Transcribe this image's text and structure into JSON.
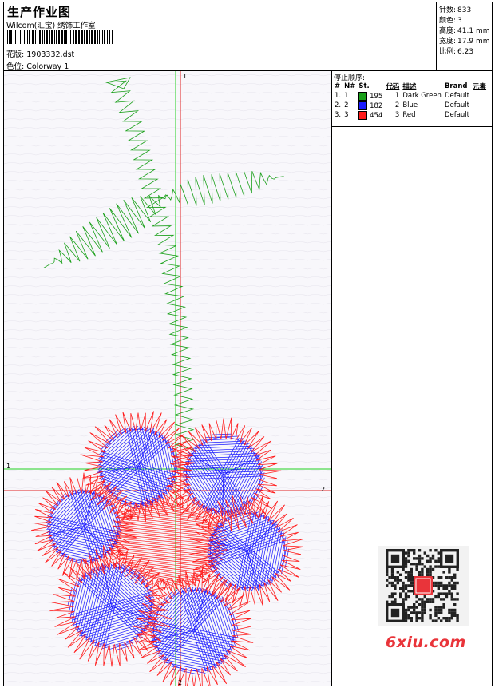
{
  "header": {
    "title": "生产作业图",
    "company": "Wilcom(汇宝) 绣饰工作室",
    "design_label": "花版:",
    "design_file": "1903332.dst",
    "colorway_label": "色位:",
    "colorway": "Colorway 1"
  },
  "stats": [
    {
      "label": "针数:",
      "value": "833"
    },
    {
      "label": "颜色:",
      "value": "3"
    },
    {
      "label": "高度:",
      "value": "41.1 mm"
    },
    {
      "label": "宽度:",
      "value": "17.9 mm"
    },
    {
      "label": "比例:",
      "value": "6.23"
    }
  ],
  "stop_sequence": {
    "title": "停止顺序:",
    "columns": [
      "#",
      "N#",
      "St.",
      "代码",
      "描述",
      "Brand",
      "元素"
    ],
    "rows": [
      {
        "idx": "1.",
        "n": "1",
        "stitches": "195",
        "code": "1",
        "desc": "Dark Green",
        "brand": "Default",
        "color": "#1aa01a"
      },
      {
        "idx": "2.",
        "n": "2",
        "stitches": "182",
        "code": "2",
        "desc": "Blue",
        "brand": "Default",
        "color": "#1b1bff"
      },
      {
        "idx": "3.",
        "n": "3",
        "stitches": "454",
        "code": "3",
        "desc": "Red",
        "brand": "Default",
        "color": "#ff1b1b"
      }
    ]
  },
  "axes": {
    "green_v_top": "1",
    "green_h_left": "1",
    "red_h_right": "2",
    "red_v_bottom": "2"
  },
  "watermark": "6xiu.com",
  "colors": {
    "green": "#1aa01a",
    "blue": "#1b1bff",
    "red": "#ff1b1b",
    "green_axis": "#22d022",
    "red_axis": "#e02020"
  }
}
